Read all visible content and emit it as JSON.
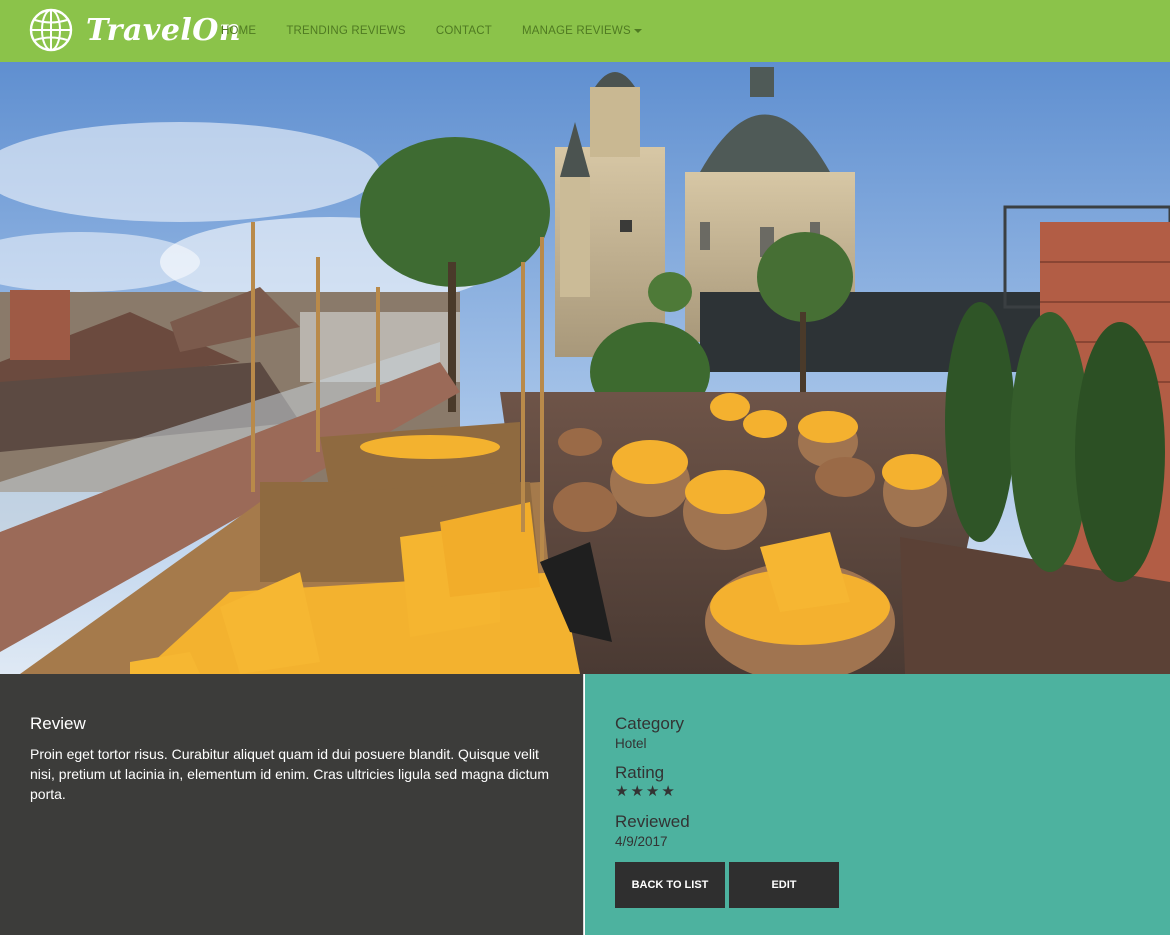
{
  "brand": {
    "name": "TravelOn",
    "logo_icon": "globe-icon"
  },
  "nav": {
    "items": [
      {
        "label": "HOME"
      },
      {
        "label": "TRENDING REVIEWS"
      },
      {
        "label": "CONTACT"
      },
      {
        "label": "MANAGE REVIEWS"
      }
    ]
  },
  "hero": {
    "image": "rooftop-terrace-photo"
  },
  "review": {
    "heading": "Review",
    "body": "Proin eget tortor risus. Curabitur aliquet quam id dui posuere blandit. Quisque velit nisi, pretium ut lacinia in, elementum id enim. Cras ultricies ligula sed magna dictum porta."
  },
  "details": {
    "category_label": "Category",
    "category_value": "Hotel",
    "rating_label": "Rating",
    "rating_stars": "★★★★",
    "rating_value": 4,
    "reviewed_label": "Reviewed",
    "reviewed_value": "4/9/2017"
  },
  "actions": {
    "back_label": "BACK TO LIST",
    "edit_label": "EDIT"
  },
  "colors": {
    "navbar": "#8bc34a",
    "left_panel": "#3c3c3a",
    "right_panel": "#4db29f",
    "button": "#2f2f2f"
  }
}
